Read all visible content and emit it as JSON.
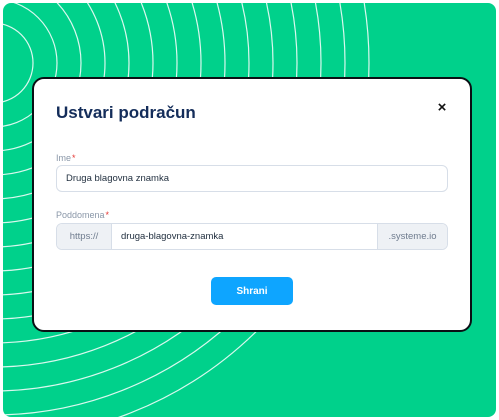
{
  "modal": {
    "title": "Ustvari podračun",
    "close_icon": "close-icon",
    "close_glyph": "×"
  },
  "fields": {
    "name": {
      "label": "Ime",
      "required_mark": "*",
      "value": "Druga blagovna znamka"
    },
    "subdomain": {
      "label": "Poddomena",
      "required_mark": "*",
      "prefix": "https://",
      "value": "druga-blagovna-znamka",
      "suffix": ".systeme.io"
    }
  },
  "actions": {
    "save_label": "Shrani"
  },
  "colors": {
    "background": "#00d18b",
    "accent": "#0ea5ff",
    "title": "#142d5a",
    "required": "#e53935"
  }
}
